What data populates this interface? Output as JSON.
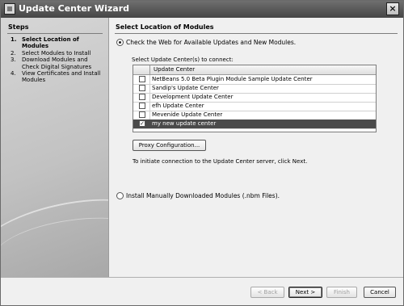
{
  "window": {
    "title": "Update Center Wizard",
    "close_glyph": "×"
  },
  "steps": {
    "title": "Steps",
    "items": [
      {
        "num": "1.",
        "label": "Select Location of Modules",
        "current": true
      },
      {
        "num": "2.",
        "label": "Select Modules to Install",
        "current": false
      },
      {
        "num": "3.",
        "label": "Download Modules and Check Digital Signatures",
        "current": false
      },
      {
        "num": "4.",
        "label": "View Certificates and Install Modules",
        "current": false
      }
    ]
  },
  "main": {
    "title": "Select Location of Modules",
    "option_web": {
      "label": "Check the Web for Available Updates and New Modules.",
      "selected": true
    },
    "list_label": "Select Update Center(s) to connect:",
    "table": {
      "column_header": "Update Center",
      "rows": [
        {
          "name": "NetBeans 5.0 Beta Plugin Module Sample Update Center",
          "checked": false,
          "selected": false
        },
        {
          "name": "Sandip's Update Center",
          "checked": false,
          "selected": false
        },
        {
          "name": "Development Update Center",
          "checked": false,
          "selected": false
        },
        {
          "name": "efh Update Center",
          "checked": false,
          "selected": false
        },
        {
          "name": "Mevenide Update Center",
          "checked": false,
          "selected": false
        },
        {
          "name": "my new update center",
          "checked": true,
          "selected": true
        }
      ]
    },
    "proxy_button": "Proxy Configuration...",
    "hint": "To initiate connection to the Update Center server, click Next.",
    "option_manual": {
      "label": "Install Manually Downloaded Modules (.nbm Files).",
      "selected": false
    }
  },
  "footer": {
    "back": "< Back",
    "next": "Next >",
    "finish": "Finish",
    "cancel": "Cancel"
  },
  "icons": {
    "check_glyph": "✓"
  }
}
